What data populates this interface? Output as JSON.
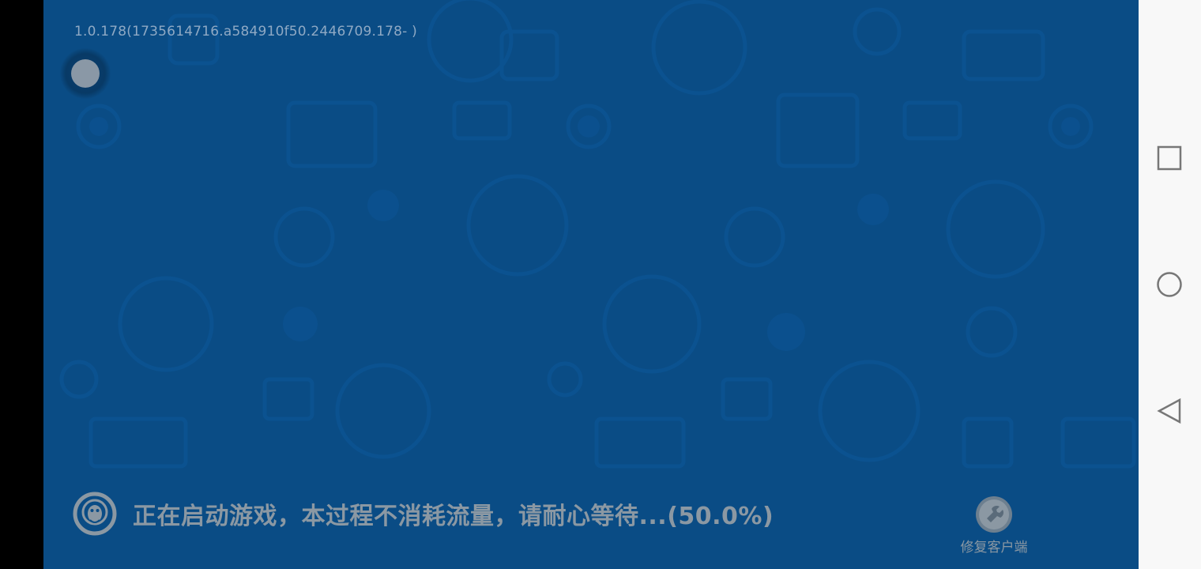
{
  "game": {
    "version_text": "1.0.178(1735614716.a584910f50.2446709.178- )",
    "loading_text": "正在启动游戏，本过程不消耗流量，请耐心等待...(50.0%)",
    "repair_label": "修复客户端",
    "background_color": "#0a4c85",
    "text_color": "#8b98a3"
  },
  "icons": {
    "floating_ball": "floating-ball-icon",
    "loading": "qq-penguin-icon",
    "repair": "repair-client-icon"
  },
  "nav": {
    "recents": "square-icon",
    "home": "circle-icon",
    "back": "triangle-back-icon",
    "background_color": "#f8f8f8"
  }
}
